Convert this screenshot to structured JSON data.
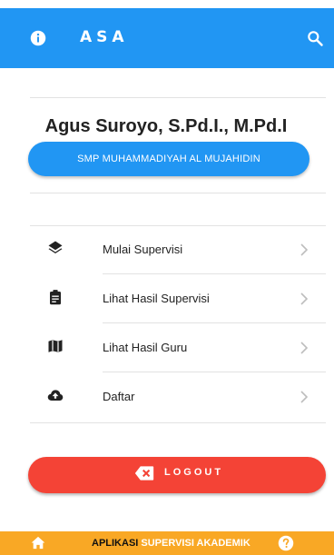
{
  "header": {
    "title": "ASA",
    "info_icon": "info-icon",
    "search_icon": "search-icon"
  },
  "profile": {
    "name": "Agus Suroyo, S.Pd.I., M.Pd.I",
    "school": "SMP MUHAMMADIYAH AL MUJAHIDIN"
  },
  "menu": [
    {
      "label": "Mulai Supervisi",
      "icon": "layers-icon"
    },
    {
      "label": "Lihat Hasil Supervisi",
      "icon": "clipboard-icon"
    },
    {
      "label": "Lihat Hasil Guru",
      "icon": "map-icon"
    },
    {
      "label": "Daftar",
      "icon": "cloud-upload-icon"
    }
  ],
  "logout": {
    "label": "LOGOUT",
    "icon": "backspace-x-icon"
  },
  "footer": {
    "label_part1": "APLIKASI",
    "label_part2": " SUPERVISI AKADEMIK",
    "home_icon": "home-icon",
    "help_icon": "help-icon"
  },
  "colors": {
    "primary": "#2196F3",
    "danger": "#F44336",
    "footer": "#F9A825"
  }
}
